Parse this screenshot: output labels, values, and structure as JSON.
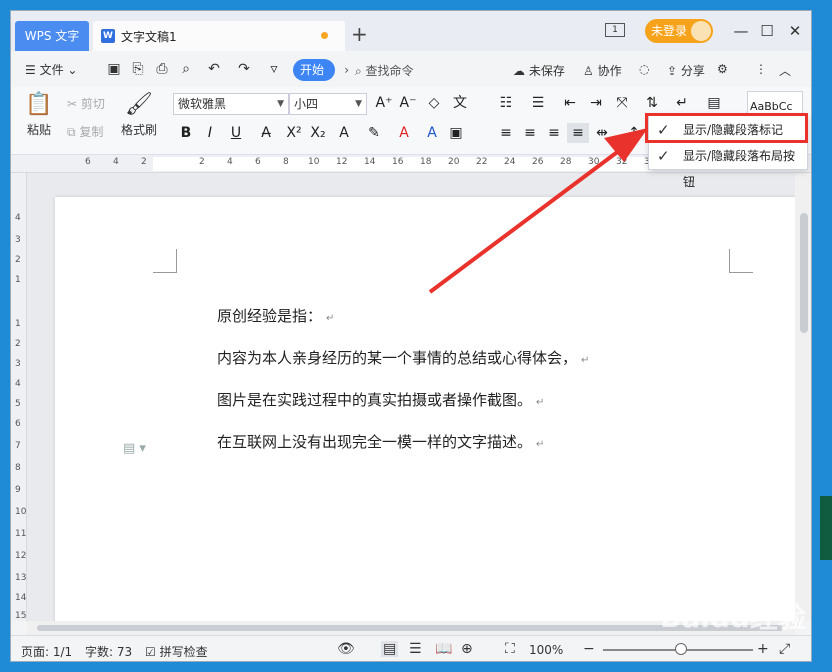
{
  "titlebar": {
    "app_tab": "WPS 文字",
    "doc_tab": "文字文稿1",
    "doc_icon_letter": "W",
    "login": "未登录"
  },
  "menubar": {
    "file": "文件",
    "start": "开始",
    "find": "查找命令",
    "unsaved": "未保存",
    "collab": "协作",
    "share": "分享"
  },
  "ribbon": {
    "paste": "粘贴",
    "cut": "剪切",
    "copy": "复制",
    "format_painter": "格式刷",
    "font_name": "微软雅黑",
    "font_size": "小四",
    "style_preview": "AaBbCc"
  },
  "ruler": {
    "h_ticks": [
      "6",
      "4",
      "2",
      "2",
      "4",
      "6",
      "8",
      "10",
      "12",
      "14",
      "16",
      "18",
      "20",
      "22",
      "24",
      "26",
      "28",
      "30",
      "32",
      "34"
    ],
    "v_ticks": [
      "4",
      "3",
      "2",
      "1",
      "1",
      "2",
      "3",
      "4",
      "5",
      "6",
      "7",
      "8",
      "9",
      "10",
      "11",
      "12",
      "13",
      "14",
      "15"
    ]
  },
  "document": {
    "paragraphs": [
      "原创经验是指：",
      "内容为本人亲身经历的某一个事情的总结或心得体会，",
      "图片是在实践过程中的真实拍摄或者操作截图。",
      "在互联网上没有出现完全一模一样的文字描述。"
    ],
    "para_mark": "↵"
  },
  "popup": {
    "items": [
      "显示/隐藏段落标记",
      "显示/隐藏段落布局按钮"
    ]
  },
  "status": {
    "page": "页面: 1/1",
    "words": "字数: 73",
    "spell": "拼写检查",
    "zoom": "100%"
  },
  "watermark": "Baidu经验",
  "colors": {
    "accent": "#3d84f5",
    "highlight": "#e8322b",
    "login": "#f7a21b"
  }
}
